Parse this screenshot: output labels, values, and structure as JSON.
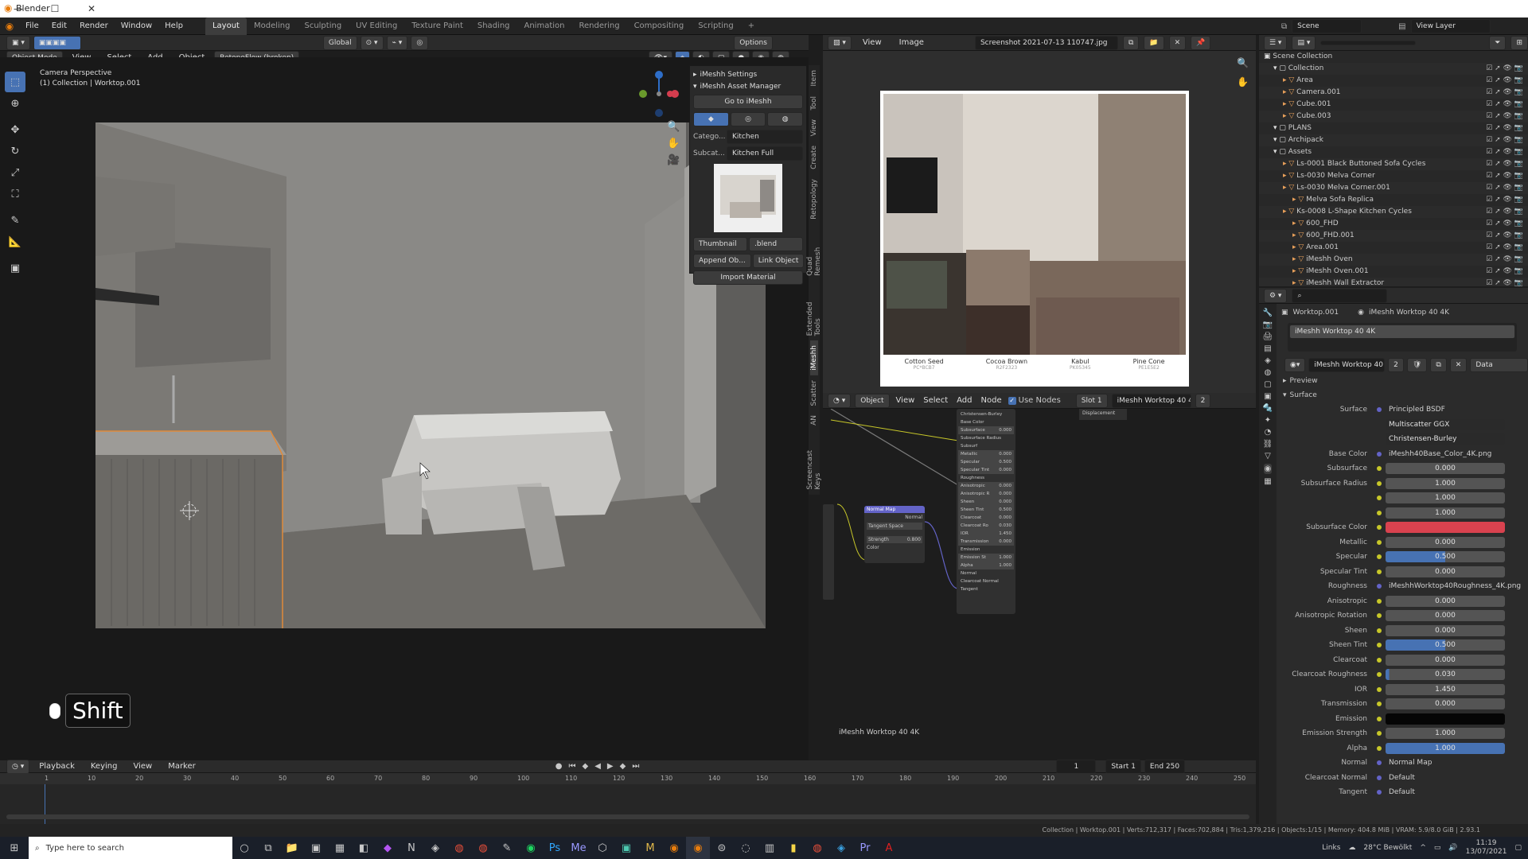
{
  "window": {
    "title": "Blender",
    "min": "—",
    "max": "☐",
    "close": "✕"
  },
  "menu": {
    "items": [
      "File",
      "Edit",
      "Render",
      "Window",
      "Help"
    ],
    "workspaces": [
      "Layout",
      "Modeling",
      "Sculpting",
      "UV Editing",
      "Texture Paint",
      "Shading",
      "Animation",
      "Rendering",
      "Compositing",
      "Scripting"
    ],
    "add_ws": "+",
    "scene": "Scene",
    "view_layer": "View Layer"
  },
  "viewport": {
    "header": {
      "mode": "Object Mode",
      "view": "View",
      "select": "Select",
      "add": "Add",
      "object": "Object",
      "retopo": "RetopoFlow (broken)",
      "transform": "Global",
      "options": "Options"
    },
    "info_line1": "Camera Perspective",
    "info_line2": "(1) Collection | Worktop.001",
    "key_hint": "Shift"
  },
  "imeshh": {
    "settings": "iMeshh Settings",
    "asset_manager": "iMeshh Asset Manager",
    "goto": "Go to iMeshh",
    "category_label": "Catego...",
    "category": "Kitchen",
    "subcat_label": "Subcat...",
    "subcat": "Kitchen Full",
    "thumbnail_btn": "Thumbnail",
    "blend_btn": ".blend",
    "append_btn": "Append Ob...",
    "link_btn": "Link Object",
    "import_btn": "Import Material"
  },
  "sidebar_tabs": [
    "Item",
    "Tool",
    "View",
    "Create",
    "Retopology",
    "Quad Remesh",
    "Extended Tools",
    "iMeshh",
    "Scatter",
    "AN",
    "Screencast Keys"
  ],
  "image_editor": {
    "view": "View",
    "image": "Image",
    "file": "Screenshot 2021-07-13 110747.jpg",
    "swatches": [
      {
        "name": "Cotton Seed",
        "code": "PC*BCB7",
        "color": "#4e5248"
      },
      {
        "name": "Cocoa Brown",
        "code": "R2F2323",
        "color": "#8c7a6c"
      },
      {
        "name": "Kabul",
        "code": "PK05345",
        "color": "#5a4840"
      },
      {
        "name": "Pine Cone",
        "code": "PE1E5E2",
        "color": "#6e5a50"
      }
    ]
  },
  "node_editor": {
    "object": "Object",
    "view": "View",
    "select": "Select",
    "add": "Add",
    "node": "Node",
    "use_nodes": "Use Nodes",
    "slot": "Slot 1",
    "material": "iMeshh Worktop 40 4K",
    "users": "2",
    "footer": "iMeshh Worktop 40 4K",
    "normal_map": {
      "title": "Normal Map",
      "out": "Normal",
      "space": "Tangent Space",
      "strength": "Strength",
      "strength_val": "0.800",
      "color": "Color"
    },
    "output_sockets": [
      "Displacement"
    ],
    "bsdf_rows": [
      "Christensen-Burley",
      "Base Color",
      "Subsurface",
      "Subsurface Radius",
      "Subsurf",
      "Metallic",
      "Specular",
      "Specular Tint",
      "Roughness",
      "Anisotropic",
      "Anisotropic R",
      "Sheen",
      "Sheen Tint",
      "Clearcoat",
      "Clearcoat Ro",
      "IOR",
      "Transmission",
      "Emission",
      "Emission St",
      "Alpha",
      "Normal",
      "Clearcoat Normal",
      "Tangent"
    ],
    "bsdf_vals": [
      "",
      "",
      "0.000",
      "",
      "",
      "0.000",
      "0.500",
      "0.000",
      "",
      "0.000",
      "0.000",
      "0.000",
      "0.500",
      "0.000",
      "0.030",
      "1.450",
      "0.000",
      "",
      "1.000",
      "1.000",
      "",
      "",
      ""
    ]
  },
  "outliner": {
    "search": "",
    "items": [
      {
        "label": "Scene Collection",
        "depth": 0
      },
      {
        "label": "Collection",
        "depth": 1
      },
      {
        "label": "Area",
        "depth": 2
      },
      {
        "label": "Camera.001",
        "depth": 2
      },
      {
        "label": "Cube.001",
        "depth": 2
      },
      {
        "label": "Cube.003",
        "depth": 2
      },
      {
        "label": "PLANS",
        "depth": 1
      },
      {
        "label": "Archipack",
        "depth": 1
      },
      {
        "label": "Assets",
        "depth": 1
      },
      {
        "label": "Ls-0001 Black Buttoned Sofa Cycles",
        "depth": 2
      },
      {
        "label": "Ls-0030 Melva Corner",
        "depth": 2
      },
      {
        "label": "Ls-0030 Melva Corner.001",
        "depth": 2
      },
      {
        "label": "Melva Sofa Replica",
        "depth": 3
      },
      {
        "label": "Ks-0008 L-Shape Kitchen Cycles",
        "depth": 2
      },
      {
        "label": "600_FHD",
        "depth": 3
      },
      {
        "label": "600_FHD.001",
        "depth": 3
      },
      {
        "label": "Area.001",
        "depth": 3
      },
      {
        "label": "iMeshh Oven",
        "depth": 3
      },
      {
        "label": "iMeshh Oven.001",
        "depth": 3
      },
      {
        "label": "iMeshh Wall Extractor",
        "depth": 3
      }
    ]
  },
  "properties": {
    "object": "Worktop.001",
    "material": "iMeshh Worktop 40 4K",
    "slot": "iMeshh Worktop 40 4K",
    "mat_name": "iMeshh Worktop 40 4K",
    "users": "2",
    "data": "Data",
    "preview": "Preview",
    "surface_panel": "Surface",
    "rows": [
      {
        "label": "Surface",
        "value": "Principled BSDF",
        "kind": "txt"
      },
      {
        "label": "",
        "value": "Multiscatter GGX",
        "kind": "drop"
      },
      {
        "label": "",
        "value": "Christensen-Burley",
        "kind": "drop"
      },
      {
        "label": "Base Color",
        "value": "iMeshh40Base_Color_4K.png",
        "kind": "txt"
      },
      {
        "label": "Subsurface",
        "value": "0.000",
        "kind": "num"
      },
      {
        "label": "Subsurface Radius",
        "value": "1.000",
        "kind": "num"
      },
      {
        "label": "",
        "value": "1.000",
        "kind": "num"
      },
      {
        "label": "",
        "value": "1.000",
        "kind": "num"
      },
      {
        "label": "Subsurface Color",
        "value": "",
        "kind": "color",
        "color": "#d9424f"
      },
      {
        "label": "Metallic",
        "value": "0.000",
        "kind": "num"
      },
      {
        "label": "Specular",
        "value": "0.500",
        "kind": "bar",
        "fill": 0.5
      },
      {
        "label": "Specular Tint",
        "value": "0.000",
        "kind": "num"
      },
      {
        "label": "Roughness",
        "value": "iMeshhWorktop40Roughness_4K.png",
        "kind": "txt"
      },
      {
        "label": "Anisotropic",
        "value": "0.000",
        "kind": "num"
      },
      {
        "label": "Anisotropic Rotation",
        "value": "0.000",
        "kind": "num"
      },
      {
        "label": "Sheen",
        "value": "0.000",
        "kind": "num"
      },
      {
        "label": "Sheen Tint",
        "value": "0.500",
        "kind": "bar",
        "fill": 0.5
      },
      {
        "label": "Clearcoat",
        "value": "0.000",
        "kind": "num"
      },
      {
        "label": "Clearcoat Roughness",
        "value": "0.030",
        "kind": "bar",
        "fill": 0.03
      },
      {
        "label": "IOR",
        "value": "1.450",
        "kind": "num"
      },
      {
        "label": "Transmission",
        "value": "0.000",
        "kind": "num"
      },
      {
        "label": "Emission",
        "value": "",
        "kind": "color",
        "color": "#050505"
      },
      {
        "label": "Emission Strength",
        "value": "1.000",
        "kind": "num"
      },
      {
        "label": "Alpha",
        "value": "1.000",
        "kind": "bar",
        "fill": 1.0
      },
      {
        "label": "Normal",
        "value": "Normal Map",
        "kind": "txt"
      },
      {
        "label": "Clearcoat Normal",
        "value": "Default",
        "kind": "txt"
      },
      {
        "label": "Tangent",
        "value": "Default",
        "kind": "txt"
      }
    ]
  },
  "timeline": {
    "playback": "Playback",
    "keying": "Keying",
    "view": "View",
    "marker": "Marker",
    "current": "1",
    "start_label": "Start",
    "start": "1",
    "end_label": "End",
    "end": "250",
    "ticks": [
      "1",
      "10",
      "20",
      "30",
      "40",
      "50",
      "60",
      "70",
      "80",
      "90",
      "100",
      "110",
      "120",
      "130",
      "140",
      "150",
      "160",
      "170",
      "180",
      "190",
      "200",
      "210",
      "220",
      "230",
      "240",
      "250"
    ]
  },
  "statusbar": {
    "text": "Collection | Worktop.001 | Verts:712,317 | Faces:702,884 | Tris:1,379,216 | Objects:1/15 | Memory: 404.8 MiB | VRAM: 5.9/8.0 GiB | 2.93.1"
  },
  "taskbar": {
    "search": "Type here to search",
    "links": "Links",
    "weather": "28°C Bewölkt",
    "time": "11:19",
    "date": "13/07/2021"
  }
}
